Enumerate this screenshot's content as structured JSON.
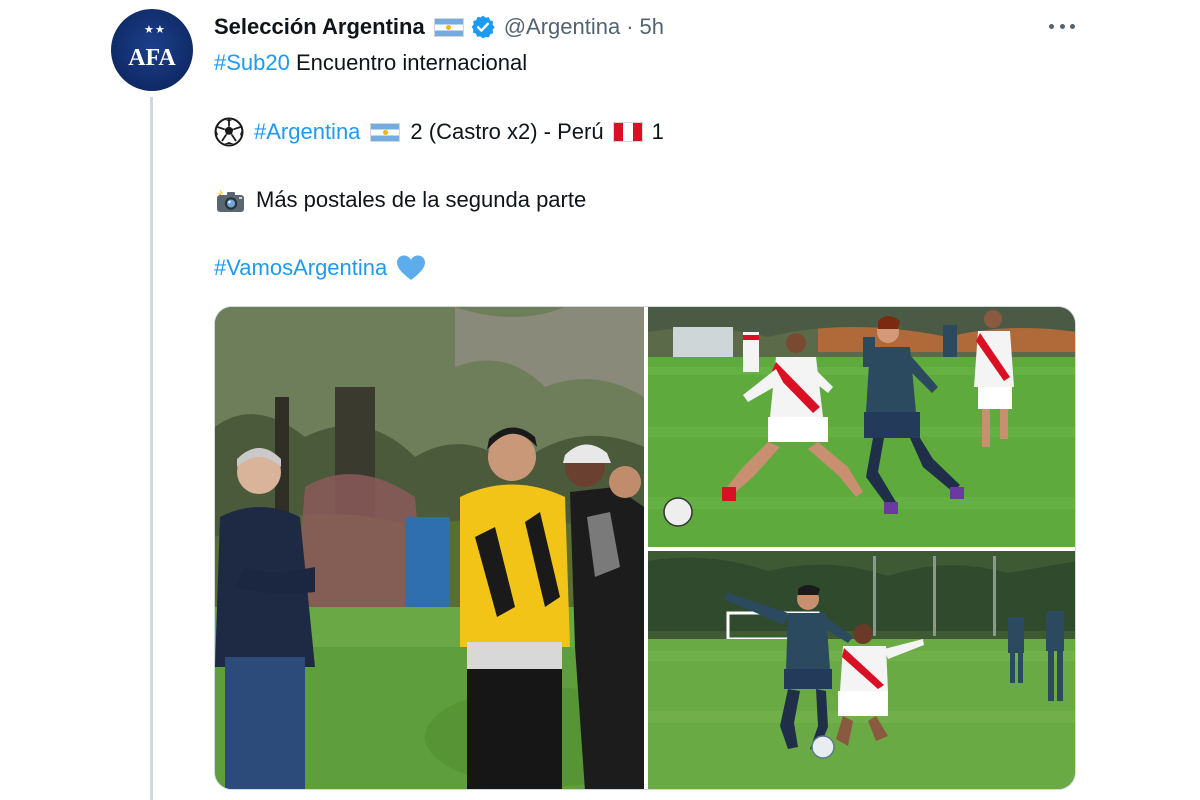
{
  "tweet": {
    "author": {
      "name": "Selección Argentina",
      "handle": "@Argentina",
      "separator": "·",
      "time": "5h",
      "avatar_text": "AFA"
    },
    "lines": {
      "line1_hashtag": "#Sub20",
      "line1_text": "Encuentro internacional",
      "line2_hashtag": "#Argentina",
      "line2_score": "2 (Castro x2) - Perú",
      "line2_score_peru": "1",
      "line3_text": "Más postales de la segunda parte",
      "line4_hashtag": "#VamosArgentina"
    },
    "icons": {
      "ball": "soccer-ball-icon",
      "camera": "camera-flash-icon",
      "heart": "blue-heart-icon",
      "verified": "verified-badge-icon",
      "more": "more-options-icon",
      "flag_argentina": "argentina-flag-icon",
      "flag_peru": "peru-flag-icon"
    },
    "media": {
      "count": 3,
      "photos": [
        "officials-sideline-photo",
        "match-action-photo-1",
        "match-action-photo-2"
      ]
    }
  },
  "colors": {
    "link": "#1d9bf0",
    "text": "#0f1419",
    "secondary": "#536471",
    "thread_line": "#cfd9de",
    "argentina_blue": "#74acdf",
    "peru_red": "#d91023"
  }
}
